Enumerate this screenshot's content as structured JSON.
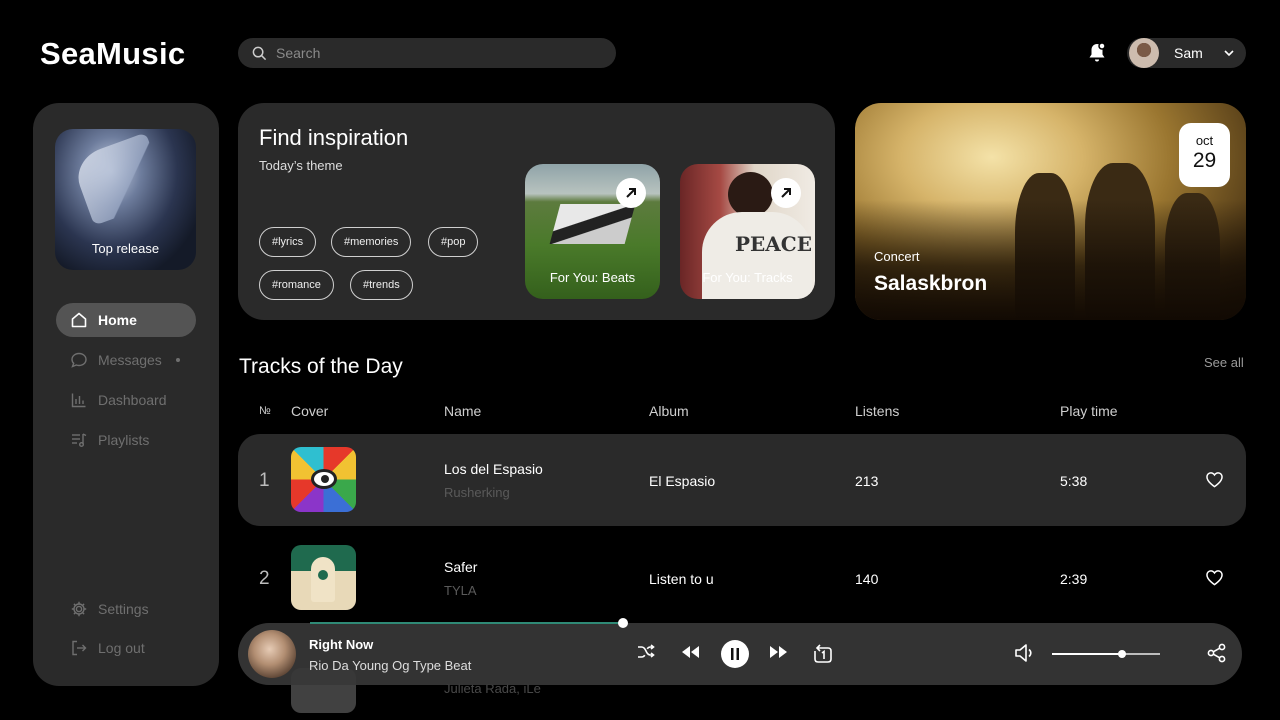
{
  "app": {
    "name": "SeaMusic"
  },
  "search": {
    "placeholder": "Search"
  },
  "user": {
    "name": "Sam"
  },
  "sidebar": {
    "top_release_label": "Top release",
    "nav": [
      {
        "label": "Home",
        "icon": "home-icon",
        "active": true
      },
      {
        "label": "Messages",
        "icon": "message-icon",
        "has_dot": true
      },
      {
        "label": "Dashboard",
        "icon": "chart-icon"
      },
      {
        "label": "Playlists",
        "icon": "playlist-icon"
      }
    ],
    "bottom": [
      {
        "label": "Settings",
        "icon": "gear-icon"
      },
      {
        "label": "Log out",
        "icon": "logout-icon"
      }
    ]
  },
  "inspiration": {
    "title": "Find inspiration",
    "subtitle": "Today’s theme",
    "tags": [
      "#lyrics",
      "#memories",
      "#pop",
      "#romance",
      "#trends"
    ],
    "cards": [
      {
        "label": "For You: Beats"
      },
      {
        "label": "For You: Tracks"
      }
    ],
    "tracks_card_text": "PEACE"
  },
  "concert": {
    "category": "Concert",
    "name": "Salaskbron",
    "month": "oct",
    "day": "29"
  },
  "tracks": {
    "title": "Tracks of the Day",
    "see_all": "See all",
    "headers": {
      "num": "№",
      "cover": "Cover",
      "name": "Name",
      "album": "Album",
      "listens": "Listens",
      "time": "Play time"
    },
    "rows": [
      {
        "num": "1",
        "name": "Los del Espasio",
        "artist": "Rusherking",
        "album": "El Espasio",
        "listens": "213",
        "time": "5:38"
      },
      {
        "num": "2",
        "name": "Safer",
        "artist": "TYLA",
        "album": "Listen to u",
        "listens": "140",
        "time": "2:39"
      },
      {
        "artist": "Julieta Rada, iLe"
      }
    ]
  },
  "player": {
    "title": "Right Now",
    "artist": "Rio Da Young Og Type Beat",
    "progress": 0.45,
    "volume": 0.63
  },
  "colors": {
    "bg": "#000000",
    "panel": "#2a2a2a",
    "accent": "#2f8a76"
  }
}
